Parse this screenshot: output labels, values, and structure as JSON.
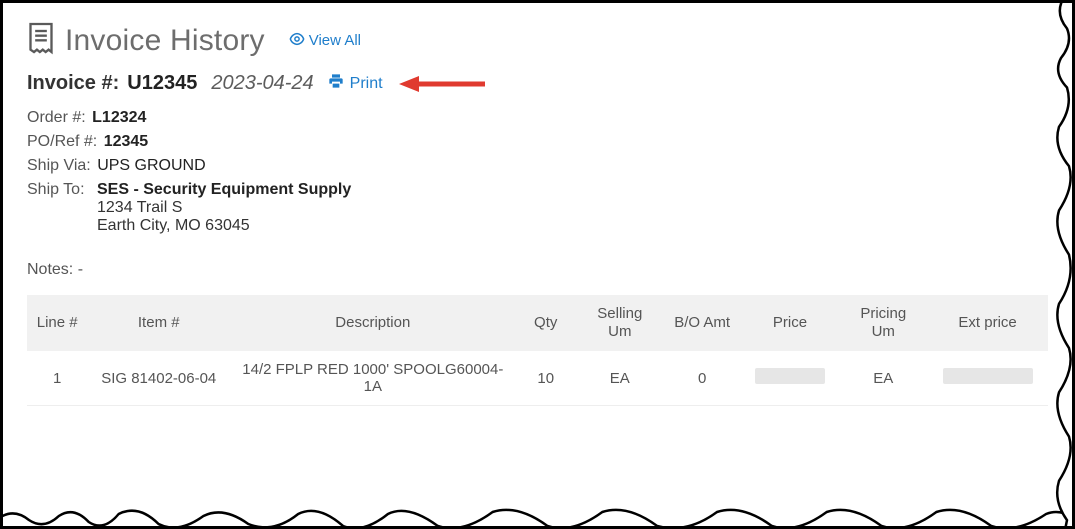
{
  "header": {
    "title": "Invoice History",
    "view_all_label": "View All"
  },
  "invoice": {
    "label": "Invoice #:",
    "number": "U12345",
    "date": "2023-04-24",
    "print_label": "Print"
  },
  "order": {
    "label": "Order #:",
    "value": "L12324"
  },
  "poref": {
    "label": "PO/Ref #:",
    "value": "12345"
  },
  "shipvia": {
    "label": "Ship Via:",
    "value": "UPS GROUND"
  },
  "shipto": {
    "label": "Ship To:",
    "name": "SES - Security Equipment Supply",
    "addr1": "1234 Trail S",
    "addr2": "Earth City, MO 63045"
  },
  "notes": {
    "label": "Notes:",
    "value": "-"
  },
  "table": {
    "headers": {
      "line": "Line #",
      "item": "Item #",
      "desc": "Description",
      "qty": "Qty",
      "sell_um": "Selling Um",
      "bo_amt": "B/O Amt",
      "price": "Price",
      "pric_um": "Pricing Um",
      "ext": "Ext price"
    },
    "rows": [
      {
        "line": "1",
        "item": "SIG 81402-06-04",
        "desc": "14/2 FPLP RED 1000' SPOOLG60004-1A",
        "qty": "10",
        "sell_um": "EA",
        "bo_amt": "0",
        "price": "",
        "pric_um": "EA",
        "ext": ""
      }
    ]
  },
  "colors": {
    "link": "#1f7ecb",
    "arrow": "#e03a2f"
  }
}
